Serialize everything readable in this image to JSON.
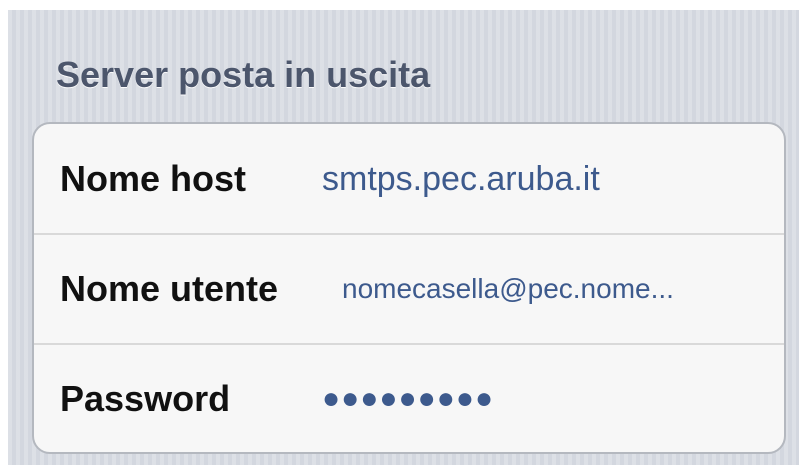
{
  "section": {
    "title": "Server posta in uscita"
  },
  "rows": [
    {
      "label": "Nome host",
      "value": "smtps.pec.aruba.it"
    },
    {
      "label": "Nome utente",
      "value": "nomecasella@pec.nome..."
    },
    {
      "label": "Password",
      "value": "●●●●●●●●●"
    }
  ],
  "colors": {
    "background": "#d3d7df",
    "header_text": "#4c566c",
    "value_text": "#3d5a8d",
    "label_text": "#111111",
    "cell_background": "#f7f7f7"
  }
}
